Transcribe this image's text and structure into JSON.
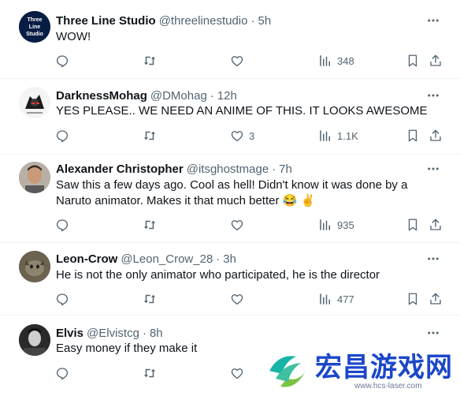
{
  "tweets": [
    {
      "name": "Three Line Studio",
      "handle": "@threelinestudio",
      "time": "5h",
      "text": "WOW!",
      "replies": "",
      "retweets": "",
      "likes": "",
      "views": "348",
      "avatar_color": "#0a2a5c"
    },
    {
      "name": "DarknessMohag",
      "handle": "@DMohag",
      "time": "12h",
      "text": "YES PLEASE.. WE NEED AN ANIME OF THIS. IT LOOKS AWESOME",
      "replies": "",
      "retweets": "",
      "likes": "3",
      "views": "1.1K",
      "avatar_color": "#2f2f2f"
    },
    {
      "name": "Alexander Christopher",
      "handle": "@itsghostmage",
      "time": "7h",
      "text": "Saw this a few days ago.  Cool as hell! Didn't know it was done by a Naruto animator.  Makes it that much better 😂 ✌️",
      "replies": "",
      "retweets": "",
      "likes": "",
      "views": "935",
      "avatar_color": "#8a7a6a"
    },
    {
      "name": "Leon-Crow",
      "handle": "@Leon_Crow_28",
      "time": "3h",
      "text": "He is not the only animator who participated, he is the director",
      "replies": "",
      "retweets": "",
      "likes": "",
      "views": "477",
      "avatar_color": "#5a5040"
    },
    {
      "name": "Elvis",
      "handle": "@Elvistcg",
      "time": "8h",
      "text": "Easy money if they make it",
      "replies": "",
      "retweets": "",
      "likes": "",
      "views": "",
      "avatar_color": "#1a1a1a"
    }
  ],
  "avatar_text": {
    "three_line_studio": "Three Line Studio"
  },
  "watermark": {
    "text": "宏昌游戏网",
    "url": "www.hcs-laser.com"
  },
  "colors": {
    "text": "#0f1419",
    "secondary": "#536471",
    "divider": "#eff3f4",
    "watermark_blue": "#1b47c9",
    "watermark_teal": "#19b4a8",
    "watermark_green": "#7cc243"
  },
  "icons": {
    "reply": "reply-icon",
    "retweet": "retweet-icon",
    "like": "like-icon",
    "views": "views-icon",
    "bookmark": "bookmark-icon",
    "share": "share-icon",
    "more": "more-icon"
  }
}
